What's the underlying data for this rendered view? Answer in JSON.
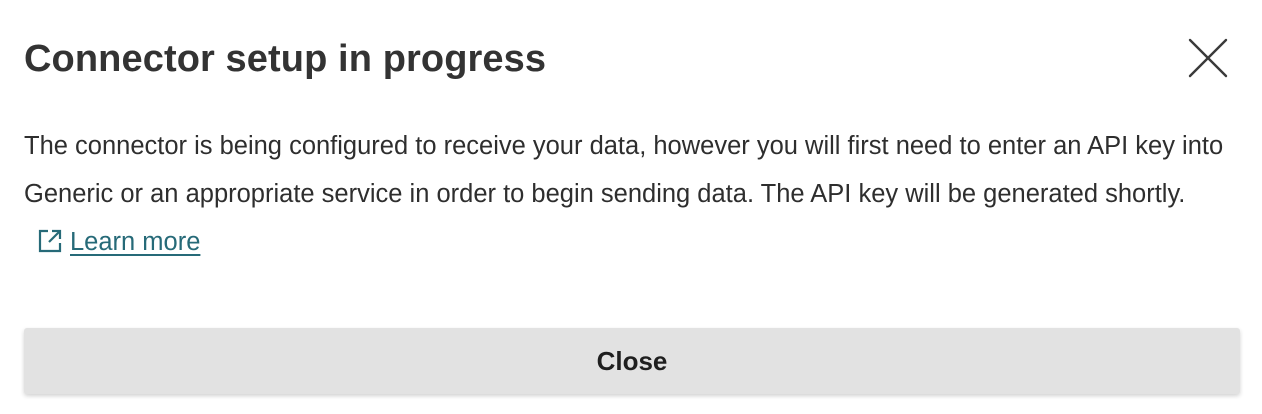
{
  "dialog": {
    "title": "Connector setup in progress",
    "body": "The connector is being configured to receive your data, however you will first need to enter an API key into Generic or an appropriate service in order to begin sending data. The API key will be generated shortly.",
    "learn_more_label": "Learn more",
    "close_button_label": "Close"
  },
  "icons": {
    "close": "close-icon",
    "external_link": "external-link-icon"
  },
  "colors": {
    "link": "#266a78",
    "button_bg": "#e2e2e2",
    "title_text": "#333333"
  }
}
